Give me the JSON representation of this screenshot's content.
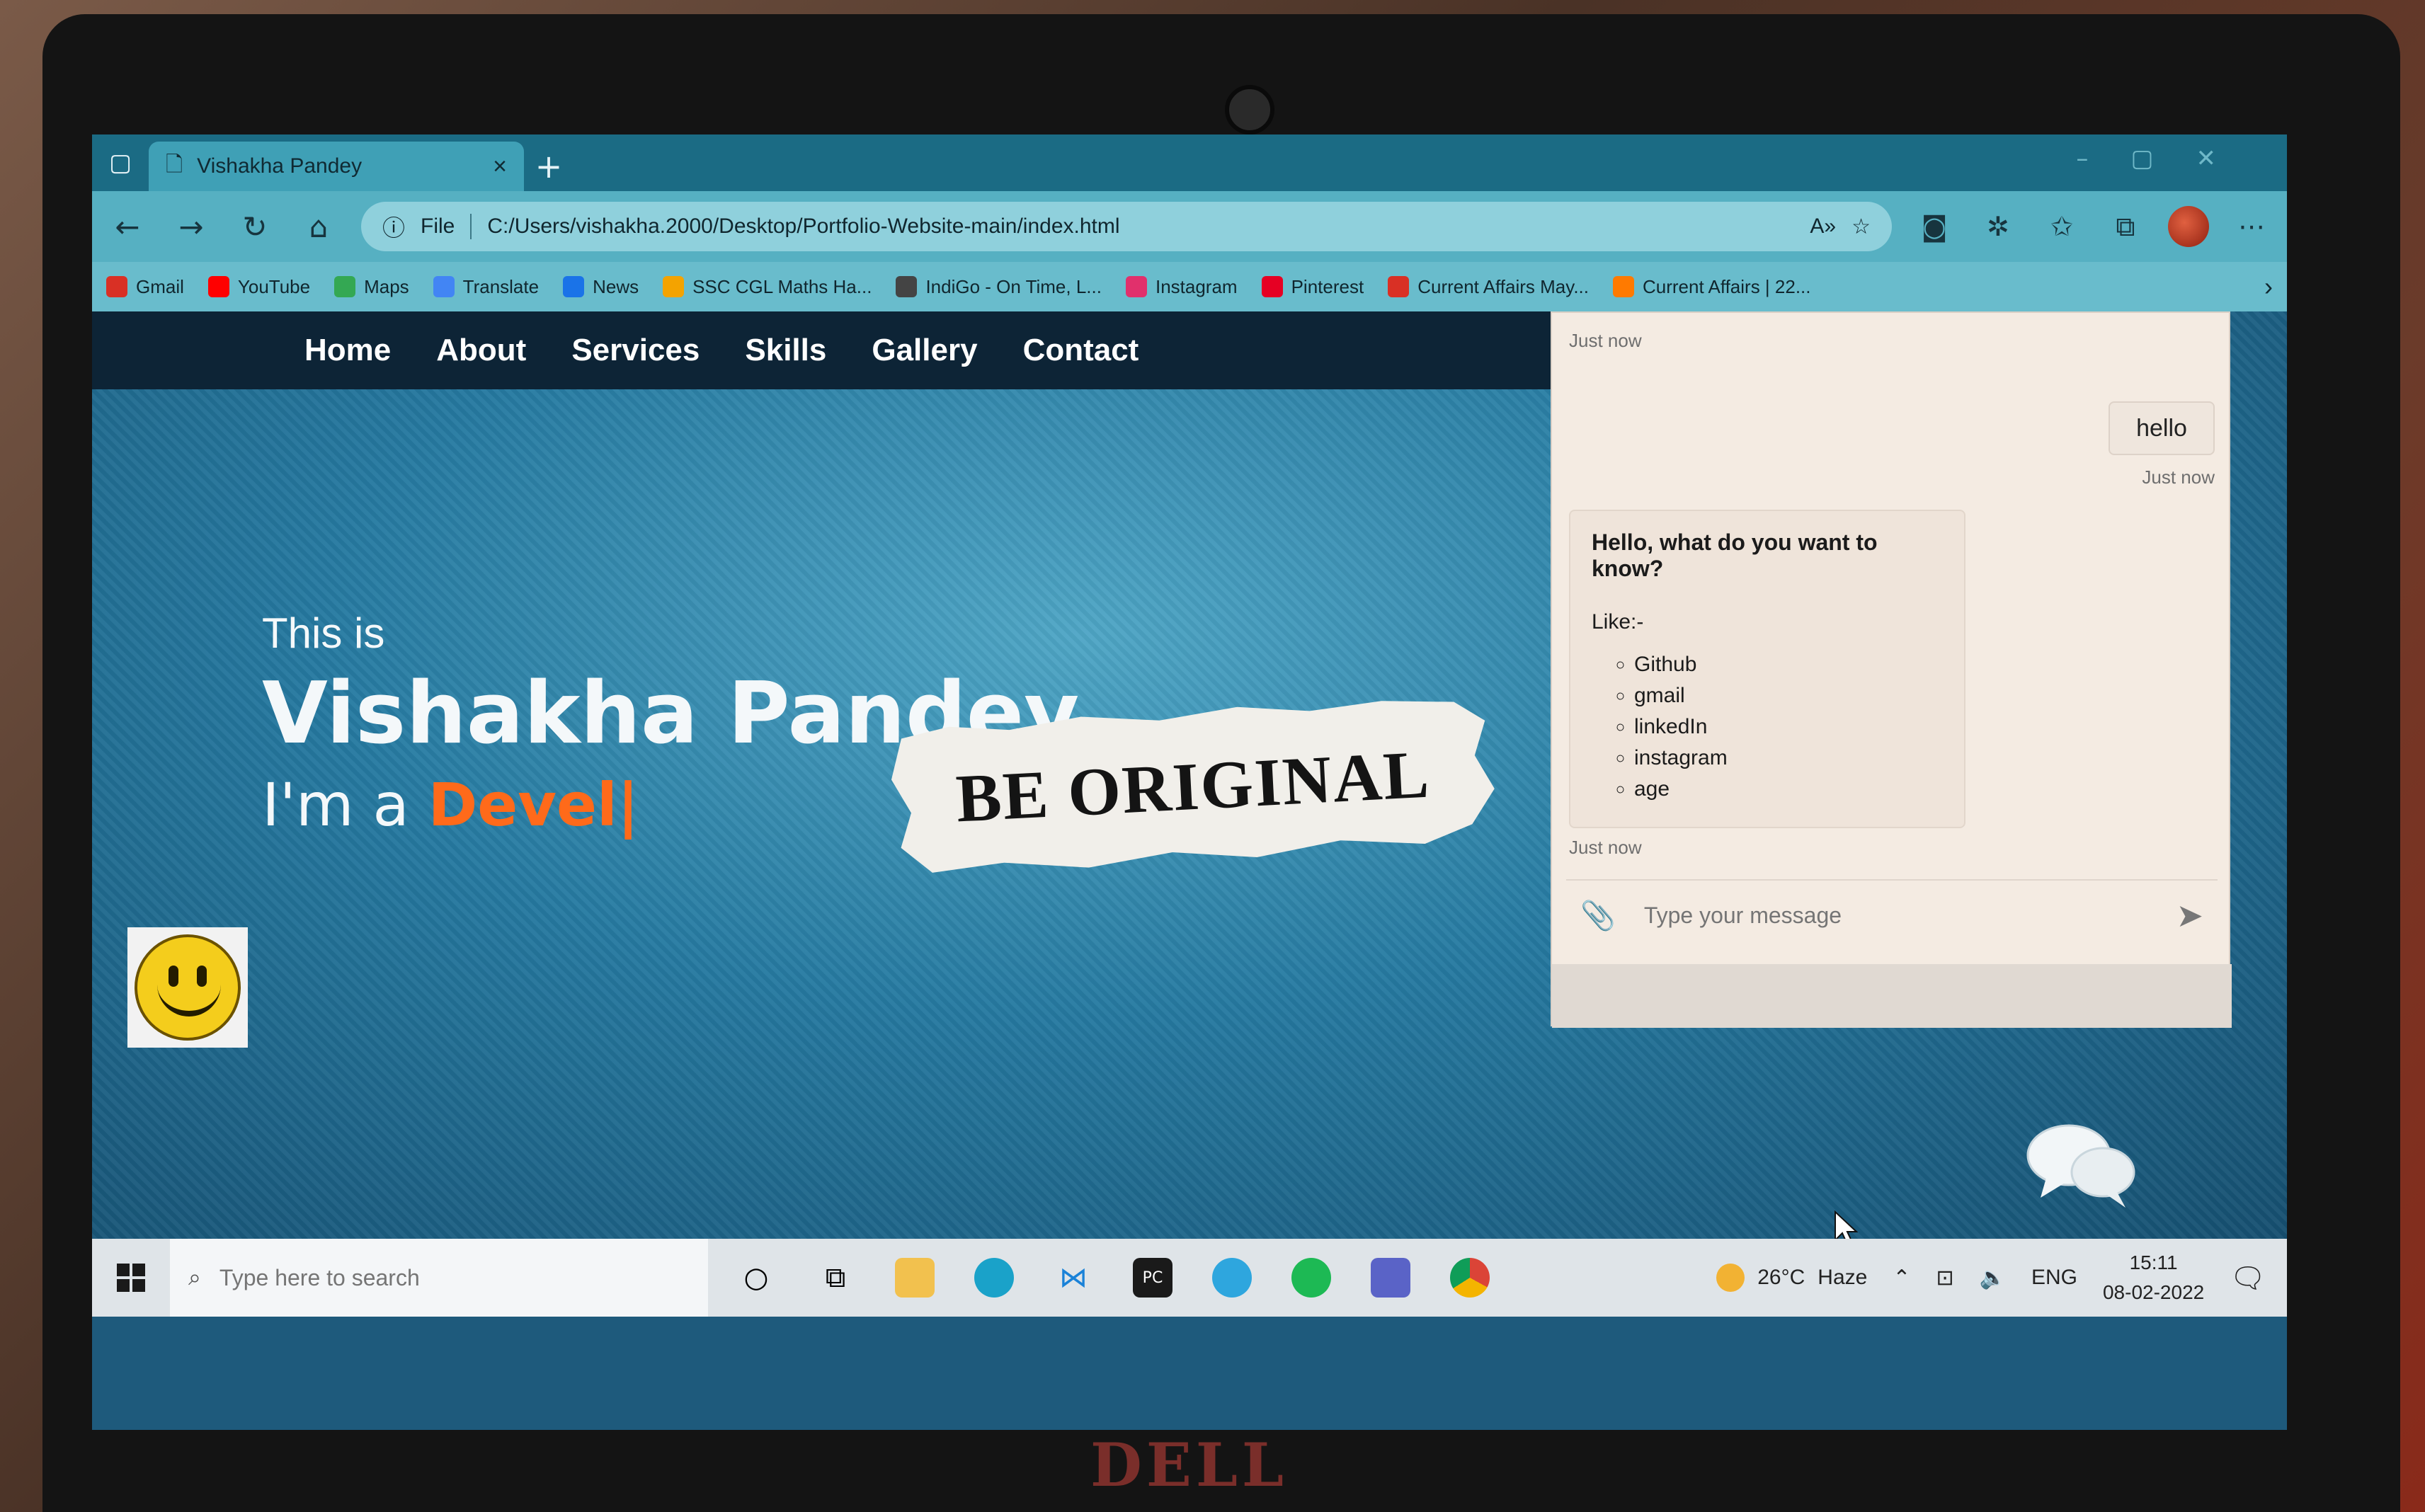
{
  "browser": {
    "tab_title": "Vishakha Pandey",
    "tab_close": "×",
    "new_tab": "+",
    "address_prefix": "File",
    "url": "C:/Users/vishakha.2000/Desktop/Portfolio-Website-main/index.html",
    "bookmarks": [
      {
        "label": "Gmail",
        "color": "#d93025"
      },
      {
        "label": "YouTube",
        "color": "#ff0000"
      },
      {
        "label": "Maps",
        "color": "#34a853"
      },
      {
        "label": "Translate",
        "color": "#4285f4"
      },
      {
        "label": "News",
        "color": "#1a73e8"
      },
      {
        "label": "SSC CGL Maths Ha...",
        "color": "#f4a300"
      },
      {
        "label": "IndiGo - On Time, L...",
        "color": "#444444"
      },
      {
        "label": "Instagram",
        "color": "#e1306c"
      },
      {
        "label": "Pinterest",
        "color": "#e60023"
      },
      {
        "label": "Current Affairs May...",
        "color": "#d93025"
      },
      {
        "label": "Current Affairs | 22...",
        "color": "#ff7a00"
      }
    ]
  },
  "nav": {
    "items": [
      "Home",
      "About",
      "Services",
      "Skills",
      "Gallery",
      "Contact"
    ]
  },
  "hero": {
    "intro": "This is",
    "name": "Vishakha Pandey",
    "role_prefix": "I'm a ",
    "role_typed": "Devel",
    "cursor": "|"
  },
  "banner": {
    "text": "BE ORIGINAL"
  },
  "chat": {
    "ts_top": "Just now",
    "user_message": "hello",
    "ts_user": "Just now",
    "bot_question": "Hello, what do you want to know?",
    "bot_like": "Like:-",
    "bot_options": [
      "Github",
      "gmail",
      "linkedIn",
      "instagram",
      "age"
    ],
    "ts_bot": "Just now",
    "input_placeholder": "Type your message"
  },
  "taskbar": {
    "search_placeholder": "Type here to search",
    "temperature": "26°C",
    "weather": "Haze",
    "language": "ENG",
    "time": "15:11",
    "date": "08-02-2022"
  },
  "laptop_brand": "DELL",
  "colors": {
    "accent_typed": "#ff6a1a",
    "nav_bg": "#0d2436",
    "browser_tab_bg": "#1b6b84"
  }
}
